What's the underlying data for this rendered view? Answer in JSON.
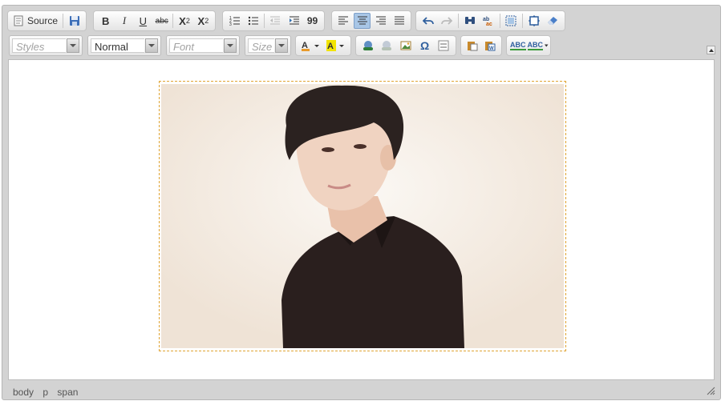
{
  "toolbar": {
    "source_label": "Source",
    "bold_label": "B",
    "italic_label": "I",
    "underline_label": "U",
    "strike_label": "abc",
    "subscript_label": "X",
    "subscript_sub": "2",
    "superscript_label": "X",
    "superscript_sup": "2",
    "blockquote_label": "99",
    "styles_placeholder": "Styles",
    "format_value": "Normal",
    "font_placeholder": "Font",
    "size_placeholder": "Size",
    "spell_label": "ABC",
    "scayt_label": "ABC"
  },
  "content": {
    "image_alt": "photo of a person in black shirt",
    "colors": {
      "image_border": "#e0a433",
      "shirt": "#2a1f1e",
      "hair": "#2b2220",
      "skin": "#ecc9b4",
      "background": "#f5efe8"
    }
  },
  "statusbar": {
    "path": [
      "body",
      "p",
      "span"
    ]
  },
  "colors": {
    "frame": "#d3d3d3",
    "active_button": "#a8c6e6",
    "link_icon": "#2f6fb2"
  }
}
